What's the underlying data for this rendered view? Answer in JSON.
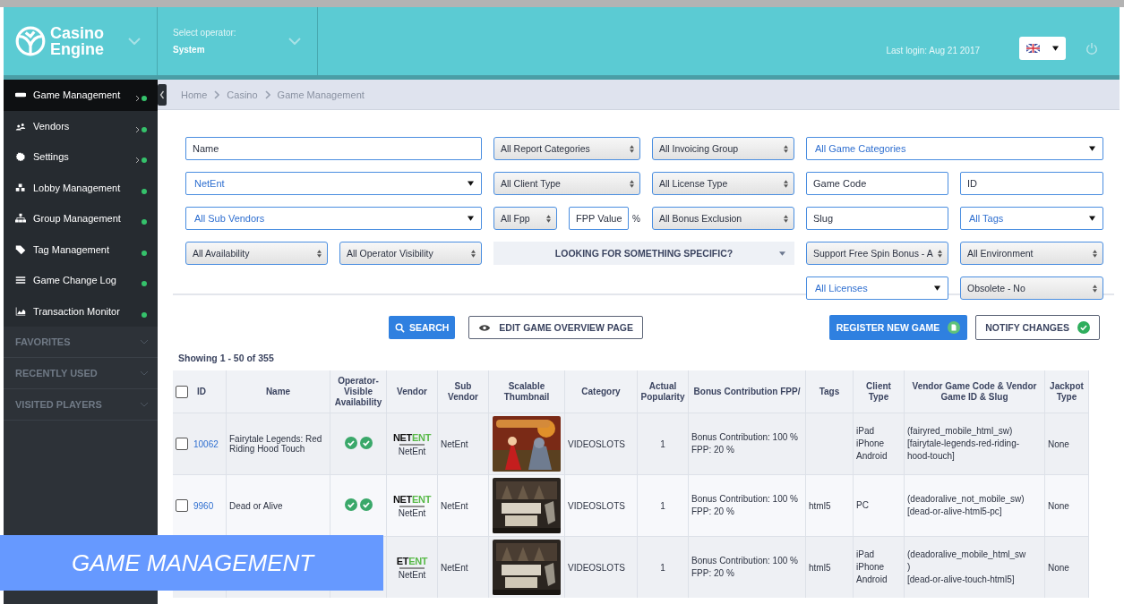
{
  "header": {
    "logo_lines": [
      "Casino",
      "Engine"
    ],
    "operator_label": "Select operator:",
    "operator": "System",
    "last_login": "Last login: Aug 21 2017"
  },
  "sidebar": {
    "items": [
      {
        "label": "Game Management",
        "selected": true,
        "has_submenu": true
      },
      {
        "label": "Vendors",
        "selected": false,
        "has_submenu": true
      },
      {
        "label": "Settings",
        "selected": false,
        "has_submenu": true
      },
      {
        "label": "Lobby Management",
        "selected": false,
        "has_submenu": false
      },
      {
        "label": "Group Management",
        "selected": false,
        "has_submenu": false
      },
      {
        "label": "Tag Management",
        "selected": false,
        "has_submenu": false
      },
      {
        "label": "Game Change Log",
        "selected": false,
        "has_submenu": false
      },
      {
        "label": "Transaction Monitor",
        "selected": false,
        "has_submenu": false
      }
    ],
    "sections": [
      "FAVORITES",
      "RECENTLY USED",
      "VISITED PLAYERS"
    ]
  },
  "breadcrumb": [
    "Home",
    "Casino",
    "Game Management"
  ],
  "filters": [
    {
      "kind": "text",
      "placeholder": "Name"
    },
    {
      "kind": "spinner",
      "value": "All Report Categories"
    },
    {
      "kind": "spinner",
      "value": "All Invoicing Group"
    },
    {
      "kind": "select",
      "value": "All Game Categories"
    },
    {
      "kind": "select",
      "value": "NetEnt"
    },
    {
      "kind": "spinner",
      "value": "All Client Type"
    },
    {
      "kind": "spinner",
      "value": "All License Type"
    },
    {
      "kind": "text",
      "placeholder": "Game Code"
    },
    {
      "kind": "text",
      "placeholder": "ID"
    },
    {
      "kind": "select",
      "value": "All Sub Vendors"
    },
    {
      "kind": "spinner",
      "value": "All Fpp"
    },
    {
      "kind": "text",
      "placeholder": "FPP Value",
      "suffix": "%"
    },
    {
      "kind": "spinner",
      "value": "All Bonus Exclusion"
    },
    {
      "kind": "text",
      "placeholder": "Slug"
    },
    {
      "kind": "select",
      "value": "All Tags"
    },
    {
      "kind": "spinner",
      "value": "All Availability"
    },
    {
      "kind": "spinner",
      "value": "All Operator Visibility"
    },
    {
      "kind": "toggle",
      "value": "LOOKING FOR SOMETHING SPECIFIC?"
    },
    {
      "kind": "spinner",
      "value": "Support Free Spin Bonus - A"
    },
    {
      "kind": "spinner",
      "value": "All Environment"
    },
    {
      "kind": "select",
      "value": "All Licenses"
    },
    {
      "kind": "spinner",
      "value": "Obsolete - No"
    }
  ],
  "actions": {
    "search": "SEARCH",
    "edit_overview": "EDIT GAME OVERVIEW PAGE",
    "register": "REGISTER NEW GAME",
    "notify": "NOTIFY CHANGES"
  },
  "showing": "Showing 1 - 50 of 355",
  "table": {
    "select_all_checked": false,
    "columns": [
      "ID",
      "Name",
      "Operator-Visible Availability",
      "Vendor",
      "Sub Vendor",
      "Scalable Thumbnail",
      "Category",
      "Actual Popularity",
      "Bonus Contribution FPP/",
      "Tags",
      "Client Type",
      "Vendor Game Code & Vendor Game ID & Slug",
      "Jackpot Type"
    ],
    "rows": [
      {
        "checked": false,
        "id": "10062",
        "name": "Fairytale Legends: Red Riding Hood Touch",
        "availability": [
          true,
          true
        ],
        "logo": [
          "NET",
          "ENT"
        ],
        "vendor": "NetEnt",
        "sub_vendor": "NetEnt",
        "thumbnail": {
          "kind": "picture"
        },
        "category": "VIDEOSLOTS",
        "popularity": "1",
        "bonus": [
          "Bonus Contribution: 100 %",
          "FPP: 20 %"
        ],
        "tags": "",
        "client": [
          "iPad",
          "iPhone",
          "Android"
        ],
        "code": [
          "(fairyred_mobile_html_sw)",
          "[fairytale-legends-red-riding-hood-touch]"
        ],
        "jackpot": "None"
      },
      {
        "checked": false,
        "id": "9960",
        "name": "Dead or Alive",
        "availability": [
          true,
          true
        ],
        "logo": [
          "NET",
          "ENT"
        ],
        "vendor": "NetEnt",
        "sub_vendor": "NetEnt",
        "thumbnail": {
          "kind": "picture"
        },
        "category": "VIDEOSLOTS",
        "popularity": "1",
        "bonus": [
          "Bonus Contribution: 100 %",
          "FPP: 20 %"
        ],
        "tags": "html5",
        "client": [
          "PC"
        ],
        "code": [
          "(deadoralive_not_mobile_sw)",
          "[dead-or-alive-html5-pc]"
        ],
        "jackpot": "None"
      },
      {
        "logo": [
          "ET",
          "ENT"
        ],
        "vendor": "NetEnt",
        "sub_vendor": "NetEnt",
        "thumbnail": {
          "kind": "picture"
        },
        "category": "VIDEOSLOTS",
        "popularity": "1",
        "bonus": [
          "Bonus Contribution: 100 %",
          "FPP: 20 %"
        ],
        "tags": "html5",
        "client": [
          "iPad",
          "iPhone",
          "Android"
        ],
        "code": [
          "(deadoralive_mobile_html_sw",
          ")",
          "[dead-or-alive-touch-html5]"
        ],
        "jackpot": "None"
      }
    ]
  },
  "caption": "GAME MANAGEMENT"
}
